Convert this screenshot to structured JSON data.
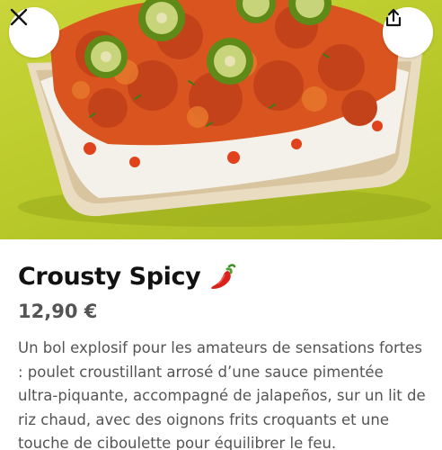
{
  "item": {
    "title": "Crousty Spicy",
    "title_icon": "chili-pepper-icon",
    "price": "12,90 €",
    "description": "Un bol explosif pour les amateurs de sensations fortes : poulet croustillant arrosé d’une sauce pimentée ultra-piquante, accompagné de jalapeños, sur un lit de riz chaud, avec des oignons frits croquants et une touche de ciboulette pour équilibrer le feu."
  },
  "header": {
    "close_icon": "close-icon",
    "share_icon": "share-icon"
  },
  "colors": {
    "hero_background": "#bccb2c",
    "title_text": "#121212",
    "secondary_text": "#545454",
    "button_background": "#ffffff"
  }
}
